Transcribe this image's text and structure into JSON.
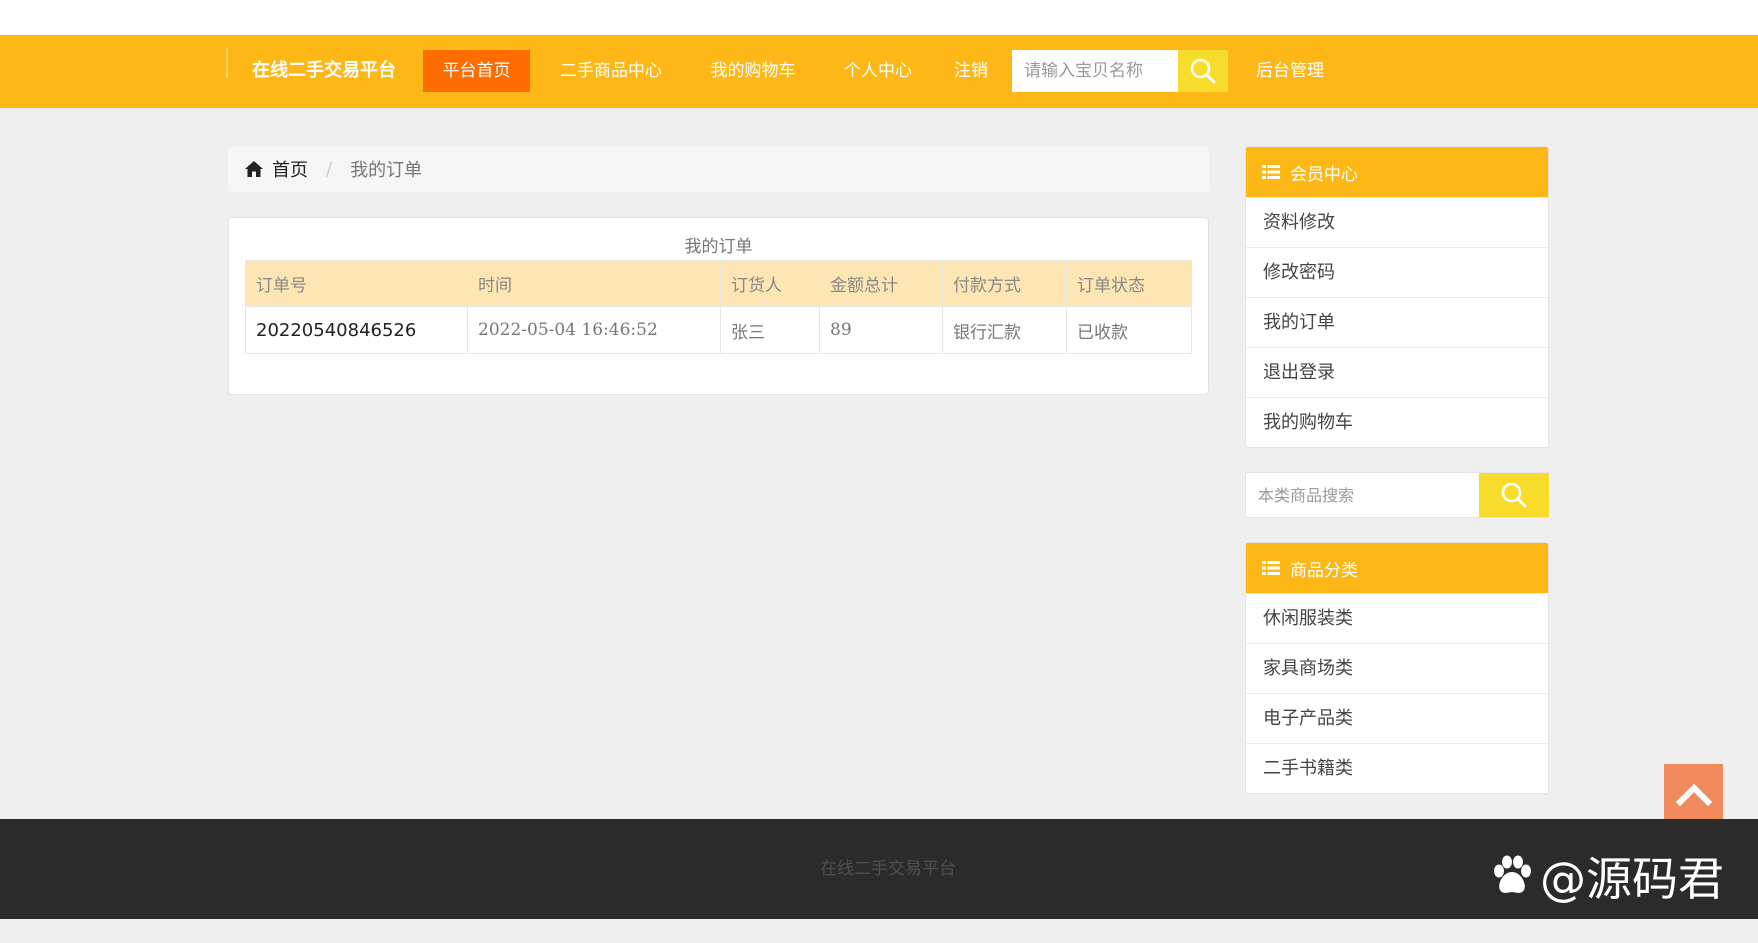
{
  "nav": {
    "brand": "在线二手交易平台",
    "items": [
      {
        "label": "平台首页",
        "active": true
      },
      {
        "label": "二手商品中心",
        "active": false
      },
      {
        "label": "我的购物车",
        "active": false
      },
      {
        "label": "个人中心",
        "active": false
      },
      {
        "label": "注销",
        "active": false
      }
    ],
    "search_placeholder": "请输入宝贝名称",
    "admin_label": "后台管理"
  },
  "breadcrumb": {
    "home": "首页",
    "separator": "/",
    "current": "我的订单"
  },
  "orders": {
    "caption": "我的订单",
    "columns": [
      "订单号",
      "时间",
      "订货人",
      "金额总计",
      "付款方式",
      "订单状态"
    ],
    "rows": [
      [
        "20220540846526",
        "2022-05-04 16:46:52",
        "张三",
        "89",
        "银行汇款",
        "已收款"
      ]
    ]
  },
  "member_center": {
    "title": "会员中心",
    "items": [
      "资料修改",
      "修改密码",
      "我的订单",
      "退出登录",
      "我的购物车"
    ]
  },
  "side_search": {
    "placeholder": "本类商品搜索"
  },
  "categories": {
    "title": "商品分类",
    "items": [
      "休闲服装类",
      "家具商场类",
      "电子产品类",
      "二手书籍类"
    ]
  },
  "footer": {
    "text": "在线二手交易平台"
  },
  "watermark": {
    "text": "@源码君"
  },
  "icons": {
    "home": "home-icon",
    "search": "search-icon",
    "list": "list-icon",
    "back_to_top": "chevron-up-icon",
    "watermark": "paw-icon"
  },
  "colors": {
    "nav_bg": "#fdb817",
    "nav_active": "#ff6c00",
    "search_btn": "#f8dc2b",
    "table_header": "#fde6b3",
    "footer_bg": "#2b2b2b",
    "back_to_top": "#f08a5c"
  }
}
